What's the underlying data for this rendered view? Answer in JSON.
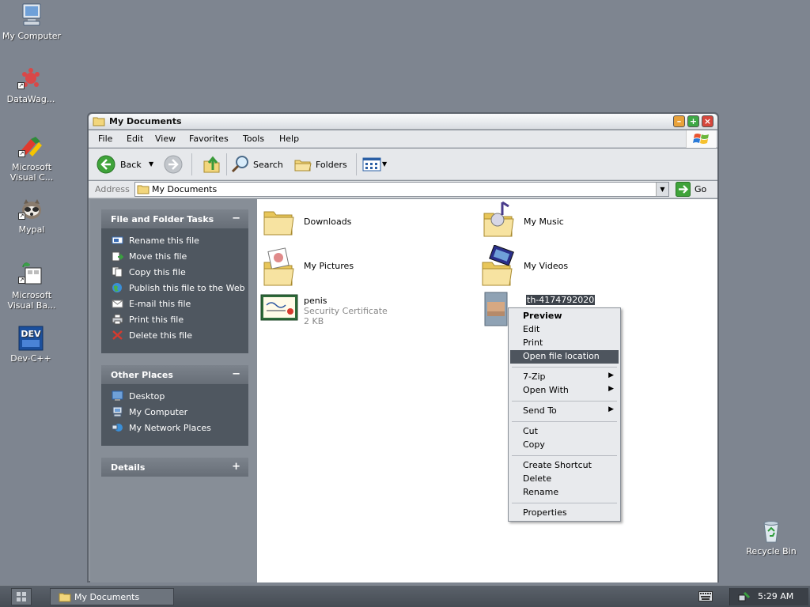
{
  "desktop": {
    "icons": [
      {
        "label": "My Computer",
        "icon": "computer-icon"
      },
      {
        "label": "DataWag...",
        "icon": "datawag-icon"
      },
      {
        "label": "Microsoft Visual C...",
        "icon": "visual-c-icon"
      },
      {
        "label": "Mypal",
        "icon": "mypal-icon"
      },
      {
        "label": "Microsoft Visual Ba...",
        "icon": "visual-basic-icon"
      },
      {
        "label": "Dev-C++",
        "icon": "devcpp-icon"
      },
      {
        "label": "Recycle Bin",
        "icon": "recycle-bin-icon"
      }
    ]
  },
  "window": {
    "title": "My Documents",
    "menu": [
      "File",
      "Edit",
      "View",
      "Favorites",
      "Tools",
      "Help"
    ],
    "toolbar": {
      "back": "Back",
      "search": "Search",
      "folders": "Folders"
    },
    "address": {
      "label": "Address",
      "value": "My Documents",
      "go": "Go"
    }
  },
  "sidebar": {
    "file_tasks": {
      "title": "File and Folder Tasks",
      "toggle": "−",
      "items": [
        "Rename this file",
        "Move this file",
        "Copy this file",
        "Publish this file to the Web",
        "E-mail this file",
        "Print this file",
        "Delete this file"
      ]
    },
    "other_places": {
      "title": "Other Places",
      "toggle": "−",
      "items": [
        "Desktop",
        "My Computer",
        "My Network Places"
      ]
    },
    "details": {
      "title": "Details",
      "toggle": "+"
    }
  },
  "files": [
    {
      "name": "Downloads",
      "type": "folder"
    },
    {
      "name": "My Music",
      "type": "music-folder"
    },
    {
      "name": "My Pictures",
      "type": "pictures-folder"
    },
    {
      "name": "My Videos",
      "type": "videos-folder"
    },
    {
      "name": "penis",
      "type": "Security Certificate",
      "size": "2 KB"
    },
    {
      "name": "th-4174792020",
      "type": "image",
      "selected": true
    }
  ],
  "context_menu": {
    "groups": [
      [
        {
          "label": "Preview",
          "bold": true
        },
        {
          "label": "Edit"
        },
        {
          "label": "Print"
        },
        {
          "label": "Open file location",
          "highlighted": true
        }
      ],
      [
        {
          "label": "7-Zip",
          "submenu": true
        },
        {
          "label": "Open With",
          "submenu": true
        }
      ],
      [
        {
          "label": "Send To",
          "submenu": true
        }
      ],
      [
        {
          "label": "Cut"
        },
        {
          "label": "Copy"
        }
      ],
      [
        {
          "label": "Create Shortcut"
        },
        {
          "label": "Delete"
        },
        {
          "label": "Rename"
        }
      ],
      [
        {
          "label": "Properties"
        }
      ]
    ]
  },
  "taskbar": {
    "task": "My Documents",
    "clock": "5:29 AM"
  },
  "colors": {
    "desktop": "#7e8590",
    "sidebar_panel": "#4f5760",
    "selection": "#3d434b",
    "menu_highlight": "#4e555e"
  }
}
